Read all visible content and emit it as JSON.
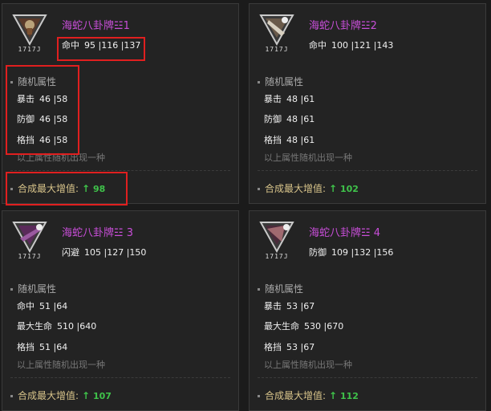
{
  "cards": [
    {
      "icon_name": "bagua-token-icon",
      "icon_number": "1717J",
      "name": "海蛇八卦牌☳1",
      "main_stat": {
        "label": "命中",
        "value": "95 |116 |137"
      },
      "random_title": "随机属性",
      "random_stats": [
        {
          "label": "暴击",
          "value": "46 |58"
        },
        {
          "label": "防御",
          "value": "46 |58"
        },
        {
          "label": "格挡",
          "value": "46 |58"
        }
      ],
      "note": "以上属性随机出现一种",
      "synth_label": "合成最大增值:",
      "synth_value": "98"
    },
    {
      "icon_name": "bagua-token-icon",
      "icon_number": "1717J",
      "name": "海蛇八卦牌☳2",
      "main_stat": {
        "label": "命中",
        "value": "100 |121 |143"
      },
      "random_title": "随机属性",
      "random_stats": [
        {
          "label": "暴击",
          "value": "48 |61"
        },
        {
          "label": "防御",
          "value": "48 |61"
        },
        {
          "label": "格挡",
          "value": "48 |61"
        }
      ],
      "note": "以上属性随机出现一种",
      "synth_label": "合成最大增值:",
      "synth_value": "102"
    },
    {
      "icon_name": "bagua-token-icon",
      "icon_number": "1717J",
      "name": "海蛇八卦牌☳ 3",
      "main_stat": {
        "label": "闪避",
        "value": "105 |127 |150"
      },
      "random_title": "随机属性",
      "random_stats": [
        {
          "label": "命中",
          "value": "51 |64"
        },
        {
          "label": "最大生命",
          "value": "510 |640"
        },
        {
          "label": "格挡",
          "value": "51 |64"
        }
      ],
      "note": "以上属性随机出现一种",
      "synth_label": "合成最大增值:",
      "synth_value": "107"
    },
    {
      "icon_name": "bagua-token-icon",
      "icon_number": "1717J",
      "name": "海蛇八卦牌☳ 4",
      "main_stat": {
        "label": "防御",
        "value": "109 |132 |156"
      },
      "random_title": "随机属性",
      "random_stats": [
        {
          "label": "暴击",
          "value": "53 |67"
        },
        {
          "label": "最大生命",
          "value": "530 |670"
        },
        {
          "label": "格挡",
          "value": "53 |67"
        }
      ],
      "note": "以上属性随机出现一种",
      "synth_label": "合成最大增值:",
      "synth_value": "112"
    }
  ],
  "colors": {
    "item_name": "#c84ed8",
    "increase": "#3fc24a",
    "highlight_box": "#e01f1f"
  }
}
